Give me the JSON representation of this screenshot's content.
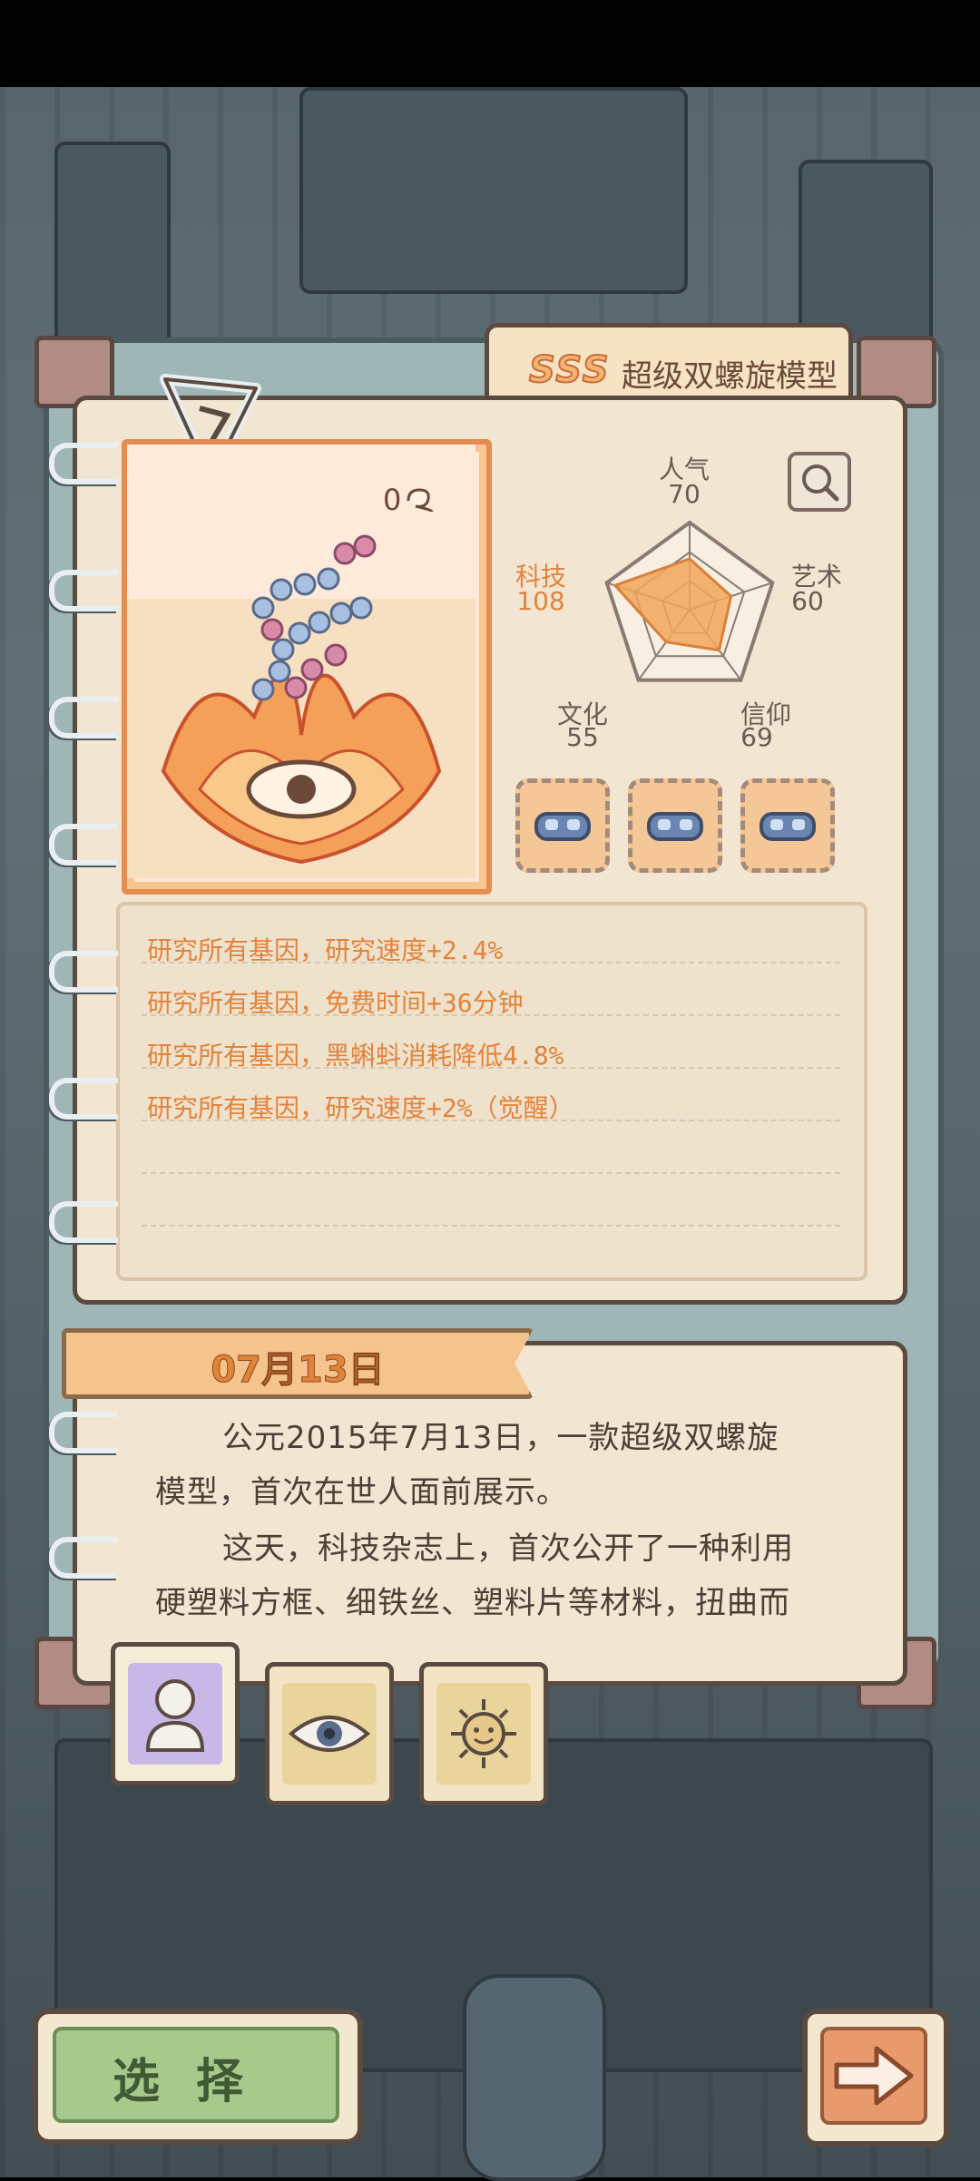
{
  "card": {
    "rank": "SSS",
    "title": "超级双螺旋模型",
    "count": "0"
  },
  "stats": {
    "popularity": {
      "label": "人气",
      "value": "70"
    },
    "art": {
      "label": "艺术",
      "value": "60"
    },
    "faith": {
      "label": "信仰",
      "value": "69"
    },
    "culture": {
      "label": "文化",
      "value": "55"
    },
    "tech": {
      "label": "科技",
      "value": "108"
    }
  },
  "stat_scale": {
    "popularity": 70,
    "art": 60,
    "faith": 69,
    "culture": 55,
    "tech": 108,
    "max": 120
  },
  "effects": [
    "研究所有基因，研究速度+2.4%",
    "研究所有基因，免费时间+36分钟",
    "研究所有基因，黑蝌蚪消耗降低4.8%",
    "研究所有基因，研究速度+2%（觉醒）"
  ],
  "story": {
    "date": "07月13日",
    "lines": [
      "公元2015年7月13日，一款超级双螺旋",
      "模型，首次在世人面前展示。",
      "这天，科技杂志上，首次公开了一种利用",
      "硬塑料方框、细铁丝、塑料片等材料，扭曲而"
    ]
  },
  "buttons": {
    "select": "选择"
  },
  "colors": {
    "accent_orange": "#e3833a",
    "panel_cream": "#f2e6d2",
    "select_green": "#a8c98c"
  }
}
